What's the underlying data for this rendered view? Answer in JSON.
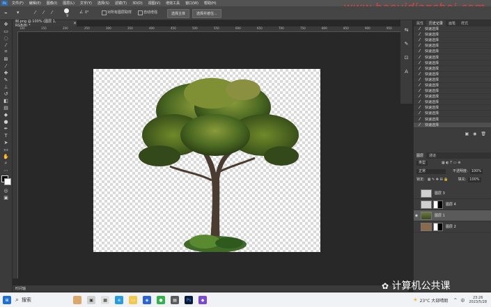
{
  "menu": {
    "logo": "Ps",
    "items": [
      "文件(F)",
      "编辑(E)",
      "图像(I)",
      "图层(L)",
      "文字(Y)",
      "选择(S)",
      "滤镜(T)",
      "3D(D)",
      "视图(V)",
      "增效工具",
      "窗口(W)",
      "帮助(H)"
    ]
  },
  "watermark": "www.haoyidianshej.com",
  "options": {
    "size_value": "9",
    "angle_value": "0°",
    "sample_all_layers": "对所有图层取样",
    "auto_enhance": "自动增强",
    "select_subject": "选择主体",
    "select_and_mask": "选择并遮住..."
  },
  "document": {
    "tab_label": "树.png @ 100% (图层 1, RGB/8) *",
    "ruler_marks": [
      "100",
      "150",
      "200",
      "250",
      "300",
      "350",
      "400",
      "450",
      "500",
      "550",
      "600",
      "650",
      "700",
      "750",
      "800",
      "850",
      "900",
      "950"
    ],
    "status": "时间轴"
  },
  "history": {
    "tabs": [
      "属性",
      "历史记录",
      "画笔",
      "样式"
    ],
    "active_tab": "历史记录",
    "items": [
      "快速选择",
      "快速选择",
      "快速选择",
      "快速选择",
      "快速选择",
      "快速选择",
      "快速选择",
      "快速选择",
      "快速选择",
      "快速选择",
      "快速选择",
      "快速选择",
      "快速选择",
      "快速选择",
      "快速选择",
      "快速选择",
      "快速选择",
      "快速选择"
    ]
  },
  "layers": {
    "tabs": [
      "图层",
      "通道"
    ],
    "filter_label": "类型",
    "blend_mode": "正常",
    "opacity_label": "不透明度:",
    "opacity_value": "100%",
    "lock_label": "锁定:",
    "fill_label": "填充:",
    "fill_value": "100%",
    "list": [
      {
        "name": "图层 3",
        "visible": false,
        "has_mask": false,
        "active": false
      },
      {
        "name": "图层 4",
        "visible": false,
        "has_mask": true,
        "active": false
      },
      {
        "name": "图层 1",
        "visible": true,
        "has_mask": false,
        "active": true
      },
      {
        "name": "图层 2",
        "visible": false,
        "has_mask": true,
        "active": false
      }
    ]
  },
  "taskbar": {
    "search": "搜索",
    "weather": "23°C 大部晴朗",
    "ime": "中",
    "time": "23:26",
    "date": "2023/5/28"
  },
  "brand_text": "计算机公共课",
  "colors": {
    "accent": "#2c6fb8",
    "panel": "#3c3c3c",
    "canvas_bg": "#282828",
    "watermark": "#e34040"
  }
}
